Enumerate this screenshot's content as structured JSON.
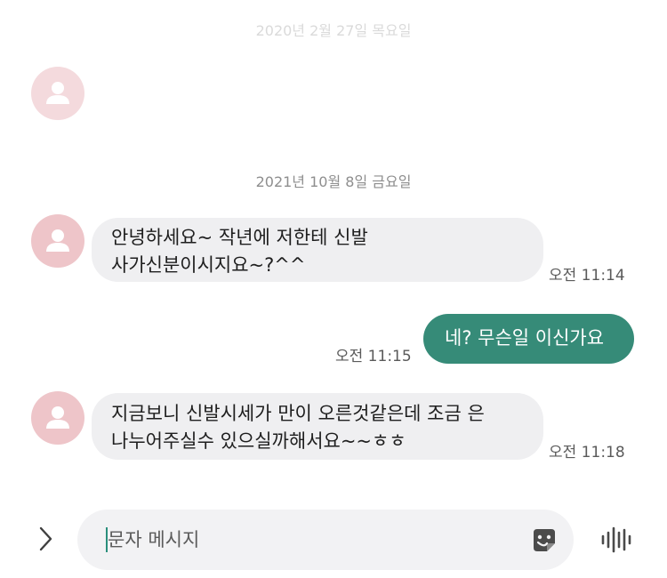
{
  "dates": {
    "faded_date": "2020년 2월 27일 목요일",
    "date_2021": "2021년 10월 8일 금요일"
  },
  "messages": [
    {
      "direction": "incoming",
      "lines": [
        "안녕하세요~ 작년에 저한테 신발",
        "사가신분이시지요~?^^"
      ],
      "time": "오전 11:14"
    },
    {
      "direction": "outgoing",
      "lines": [
        "네? 무슨일 이신가요"
      ],
      "time": "오전 11:15"
    },
    {
      "direction": "incoming",
      "lines": [
        "지금보니 신발시세가 만이 오른것같은데 조금 은",
        "나누어주실수 있으실까해서요~~ㅎㅎ"
      ],
      "time": "오전 11:18"
    }
  ],
  "composer": {
    "placeholder": "문자 메시지"
  },
  "icons": {
    "avatar": "person-icon",
    "expand": "chevron-right-icon",
    "sticker": "sticker-icon",
    "voice": "voice-waveform-icon"
  },
  "colors": {
    "outgoing_bubble": "#368b78",
    "incoming_bubble": "#efeff1",
    "avatar_bg": "#eec5c9"
  }
}
